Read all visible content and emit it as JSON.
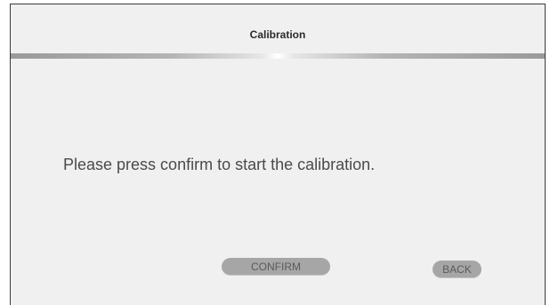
{
  "header": {
    "title": "Calibration"
  },
  "main": {
    "message": "Please press confirm to start the calibration."
  },
  "buttons": {
    "confirm_label": "CONFIRM",
    "back_label": "BACK"
  },
  "colors": {
    "panel_background": "#f0f0f0",
    "button_background": "#a6a6a6",
    "button_text": "#5a5a5a",
    "message_text": "#4a4a4a"
  }
}
